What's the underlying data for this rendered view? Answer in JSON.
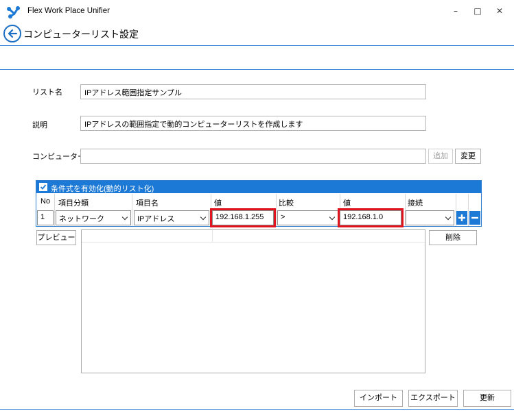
{
  "app": {
    "title": "Flex Work Place Unifier"
  },
  "window_controls": {
    "minimize": "–",
    "maximize": "□",
    "close": "✕"
  },
  "page": {
    "title": "コンピューターリスト設定"
  },
  "form": {
    "list_name_label": "リスト名",
    "list_name_value": "IPアドレス範囲指定サンプル",
    "description_label": "説明",
    "description_value": "IPアドレスの範囲指定で動的コンピューターリストを作成します",
    "computer_name_label": "コンピューター名",
    "computer_name_value": "",
    "add_button": "追加",
    "change_button": "変更"
  },
  "conditions": {
    "enabled_label": "条件式を有効化(動的リスト化)",
    "enabled": true,
    "columns": [
      "No",
      "項目分類",
      "項目名",
      "値",
      "比較",
      "値",
      "接続"
    ],
    "rows": [
      {
        "no": "1",
        "category": "ネットワーク",
        "item": "IPアドレス",
        "value1": "192.168.1.255",
        "compare": ">",
        "value2": "192.168.1.0",
        "connect": ""
      }
    ]
  },
  "preview": {
    "preview_button": "プレビュー",
    "delete_button": "削除"
  },
  "footer": {
    "import_button": "インポート",
    "export_button": "エクスポート",
    "update_button": "更新"
  },
  "colors": {
    "accent": "#1c79d6",
    "highlight": "#e0141e",
    "line": "#3c8ad8"
  }
}
